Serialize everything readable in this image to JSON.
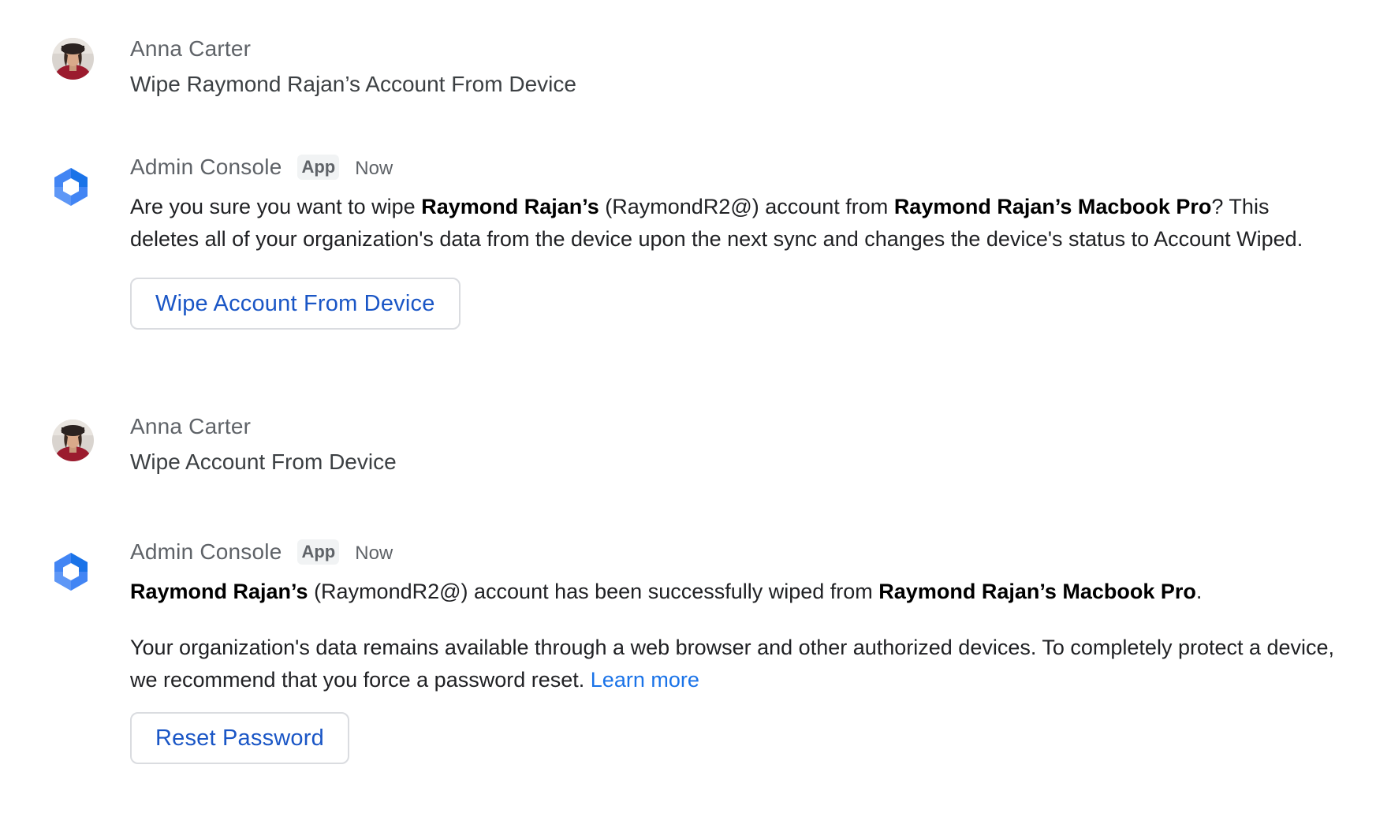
{
  "messages": [
    {
      "sender": "Anna Carter",
      "text": "Wipe Raymond Rajan’s Account From Device",
      "avatar_icon": "user-avatar"
    },
    {
      "sender": "Admin Console",
      "badge": "App",
      "time": "Now",
      "icon": "admin-console-icon",
      "text_parts": {
        "p1": "Are you sure you want to wipe ",
        "b1": "Raymond Rajan’s",
        "p2": " (RaymondR2@) account from ",
        "b2": "Raymond Rajan’s Macbook Pro",
        "p3": "? This deletes all of your organization's data from the device upon the next sync and changes the device's status to Account Wiped."
      },
      "button_label": "Wipe Account From Device"
    },
    {
      "sender": "Anna Carter",
      "text": "Wipe Account From Device",
      "avatar_icon": "user-avatar"
    },
    {
      "sender": "Admin Console",
      "badge": "App",
      "time": "Now",
      "icon": "admin-console-icon",
      "text_parts": {
        "b1": "Raymond Rajan’s",
        "p1": " (RaymondR2@) account has been successfully wiped from ",
        "b2": "Raymond Rajan’s Macbook Pro",
        "p2": ".",
        "p3": "Your organization's data remains available through a web browser and other authorized devices. To completely protect a device, we recommend that you force a password reset. ",
        "link": "Learn more"
      },
      "button_label": "Reset Password"
    }
  ],
  "colors": {
    "accent": "#1a73e8",
    "button_text": "#1a56c6",
    "muted_text": "#5f6368",
    "icon_blue": "#4285f4"
  }
}
